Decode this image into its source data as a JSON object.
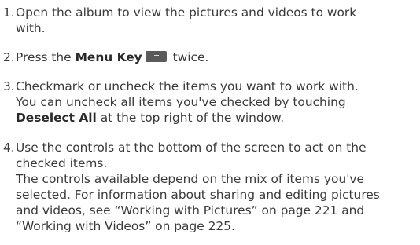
{
  "steps": [
    {
      "number": "1.",
      "lines": [
        "Open the album to view the pictures and videos to work",
        "with."
      ]
    },
    {
      "number": "2.",
      "pre": "Press the ",
      "bold": "Menu Key",
      "icon": "menu-key-icon",
      "post": " twice."
    },
    {
      "number": "3.",
      "lines": [
        "Checkmark or uncheck the items you want to work with.",
        "You can uncheck all items you've checked by touching"
      ],
      "last_bold": "Deselect All",
      "last_post": " at the top right of the window."
    },
    {
      "number": "4.",
      "lines": [
        "Use the controls at the bottom of the screen to act on the",
        "checked items.",
        "The controls available depend on the mix of items you've",
        "selected. For information about sharing and editing pictures",
        "and videos, see “Working with Pictures” on page 221 and",
        "“Working with Videos” on page 225."
      ]
    }
  ]
}
